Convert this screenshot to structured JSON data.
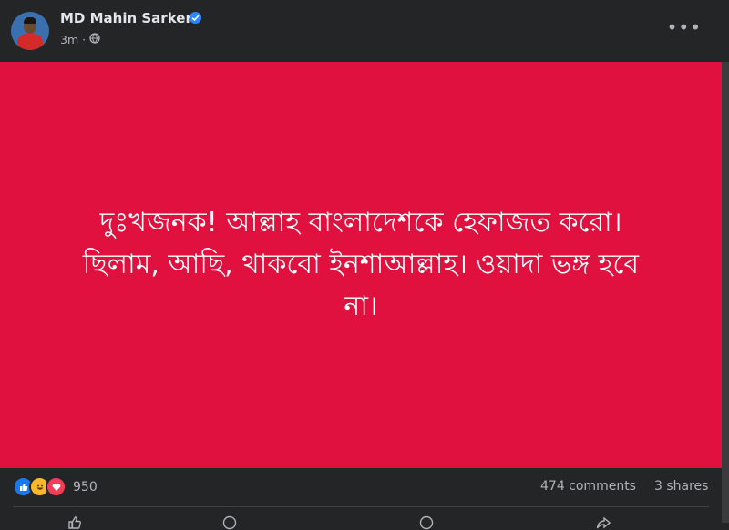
{
  "post": {
    "author": "MD Mahin Sarker",
    "time": "3m",
    "text_lines": [
      "দুঃখজনক! আল্লাহ বাংলাদেশকে হেফাজত করো।",
      "ছিলাম, আছি, থাকবো ইনশাআল্লাহ। ওয়াদা ভঙ্গ হবে",
      "না।"
    ],
    "background_color": "#e0103f"
  },
  "stats": {
    "reaction_count": "950",
    "comments": "474 comments",
    "shares": "3 shares"
  },
  "colors": {
    "panel": "#242526",
    "text": "#e4e6eb",
    "muted": "#b0b3b8",
    "verified": "#2d88ff"
  }
}
